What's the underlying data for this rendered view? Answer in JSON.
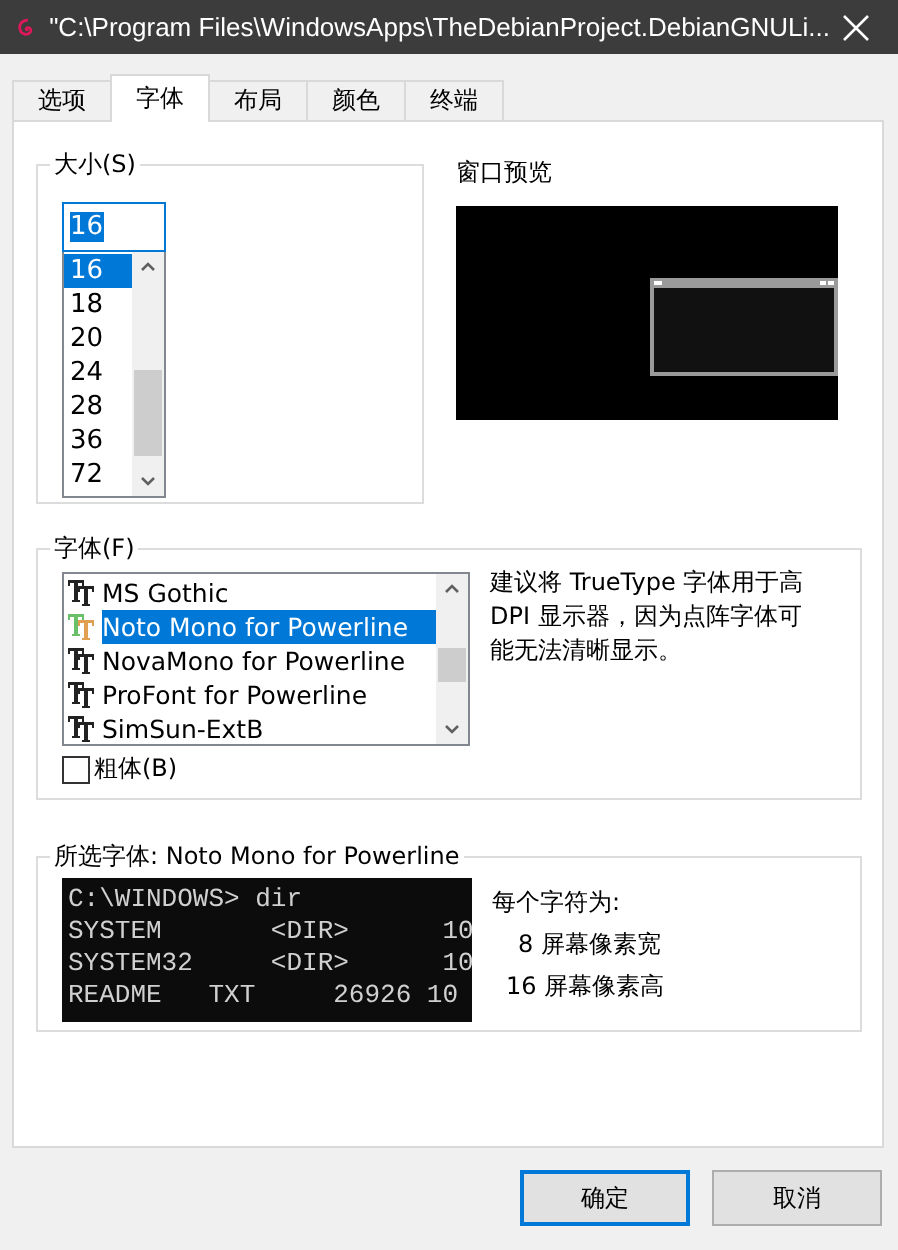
{
  "window": {
    "title": "\"C:\\Program Files\\WindowsApps\\TheDebianProject.DebianGNULi..."
  },
  "tabs": [
    {
      "label": "选项",
      "selected": false
    },
    {
      "label": "字体",
      "selected": true
    },
    {
      "label": "布局",
      "selected": false
    },
    {
      "label": "颜色",
      "selected": false
    },
    {
      "label": "终端",
      "selected": false
    }
  ],
  "size_group": {
    "label": "大小(S)",
    "value": "16",
    "options": [
      {
        "label": "16",
        "selected": true
      },
      {
        "label": "18",
        "selected": false
      },
      {
        "label": "20",
        "selected": false
      },
      {
        "label": "24",
        "selected": false
      },
      {
        "label": "28",
        "selected": false
      },
      {
        "label": "36",
        "selected": false
      },
      {
        "label": "72",
        "selected": false
      }
    ]
  },
  "preview": {
    "label": "窗口预览"
  },
  "font_group": {
    "label": "字体(F)",
    "fonts": [
      {
        "name": "MS Gothic",
        "selected": false
      },
      {
        "name": "Noto Mono for Powerline",
        "selected": true
      },
      {
        "name": "NovaMono for Powerline",
        "selected": false
      },
      {
        "name": "ProFont for Powerline",
        "selected": false
      },
      {
        "name": "SimSun-ExtB",
        "selected": false
      }
    ],
    "note": "建议将 TrueType 字体用于高 DPI 显示器，因为点阵字体可能无法清晰显示。",
    "bold": {
      "label": "粗体(B)",
      "checked": false
    }
  },
  "selected_font": {
    "label": "所选字体: Noto Mono for Powerline",
    "console_lines": [
      "C:\\WINDOWS> dir",
      "SYSTEM       <DIR>      10",
      "SYSTEM32     <DIR>      10",
      "README   TXT     26926 10"
    ],
    "char_info": {
      "heading": "每个字符为:",
      "width": "8 屏幕像素宽",
      "height": "16 屏幕像素高"
    }
  },
  "buttons": [
    {
      "label": "确定",
      "default": true
    },
    {
      "label": "取消",
      "default": false
    }
  ]
}
